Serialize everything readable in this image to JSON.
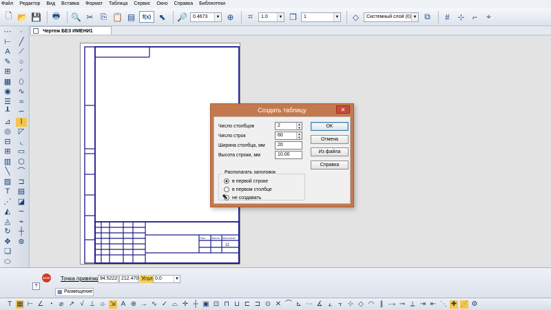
{
  "menu": [
    "Файл",
    "Редактор",
    "Вид",
    "Вставка",
    "Формат",
    "Таблица",
    "Сервис",
    "Окно",
    "Справка",
    "Библиотеки"
  ],
  "toolbar": {
    "zoom_value": "0.4673",
    "line_scale": "1.0",
    "layer_number": "1",
    "layer_name": "Системный слой (0)",
    "fx_label": "f(x)"
  },
  "document": {
    "tab_title": "Чертеж БЕЗ ИМЕНИ1"
  },
  "dialog": {
    "title": "Создать таблицу",
    "close_glyph": "✕",
    "fields": [
      {
        "label": "Число столбцов",
        "value": "2"
      },
      {
        "label": "Число строк",
        "value": "60"
      },
      {
        "label": "Ширина столбца, мм",
        "value": "20"
      },
      {
        "label": "Высота строки, мм",
        "value": "10.00"
      }
    ],
    "buttons": {
      "ok": "OK",
      "cancel": "Отмена",
      "from_file": "Из файла",
      "help": "Справка"
    },
    "header_group": {
      "title": "Располагать заголовок",
      "options": [
        "в первой строке",
        "в первом столбце",
        "не создавать"
      ],
      "selected_index": 0
    }
  },
  "properties": {
    "snap_label": "Точка привязки",
    "x": "94.5222",
    "y": "212.470",
    "angle_label": "Угол",
    "angle_value": "0.0",
    "stop_label": "STOP",
    "help_glyph": "?",
    "place_tab": "Размещение"
  },
  "sheet": {
    "frame_color": "#1a1a8c",
    "stamp_number": "11",
    "stamp_labels": [
      "Лит.",
      "Масса",
      "Масштаб"
    ]
  },
  "colors": {
    "dialog_frame": "#c3794d",
    "dialog_close": "#c94a3a",
    "canvas_bg": "#e3e3e3",
    "drawing_lines": "#1a1a8c"
  }
}
